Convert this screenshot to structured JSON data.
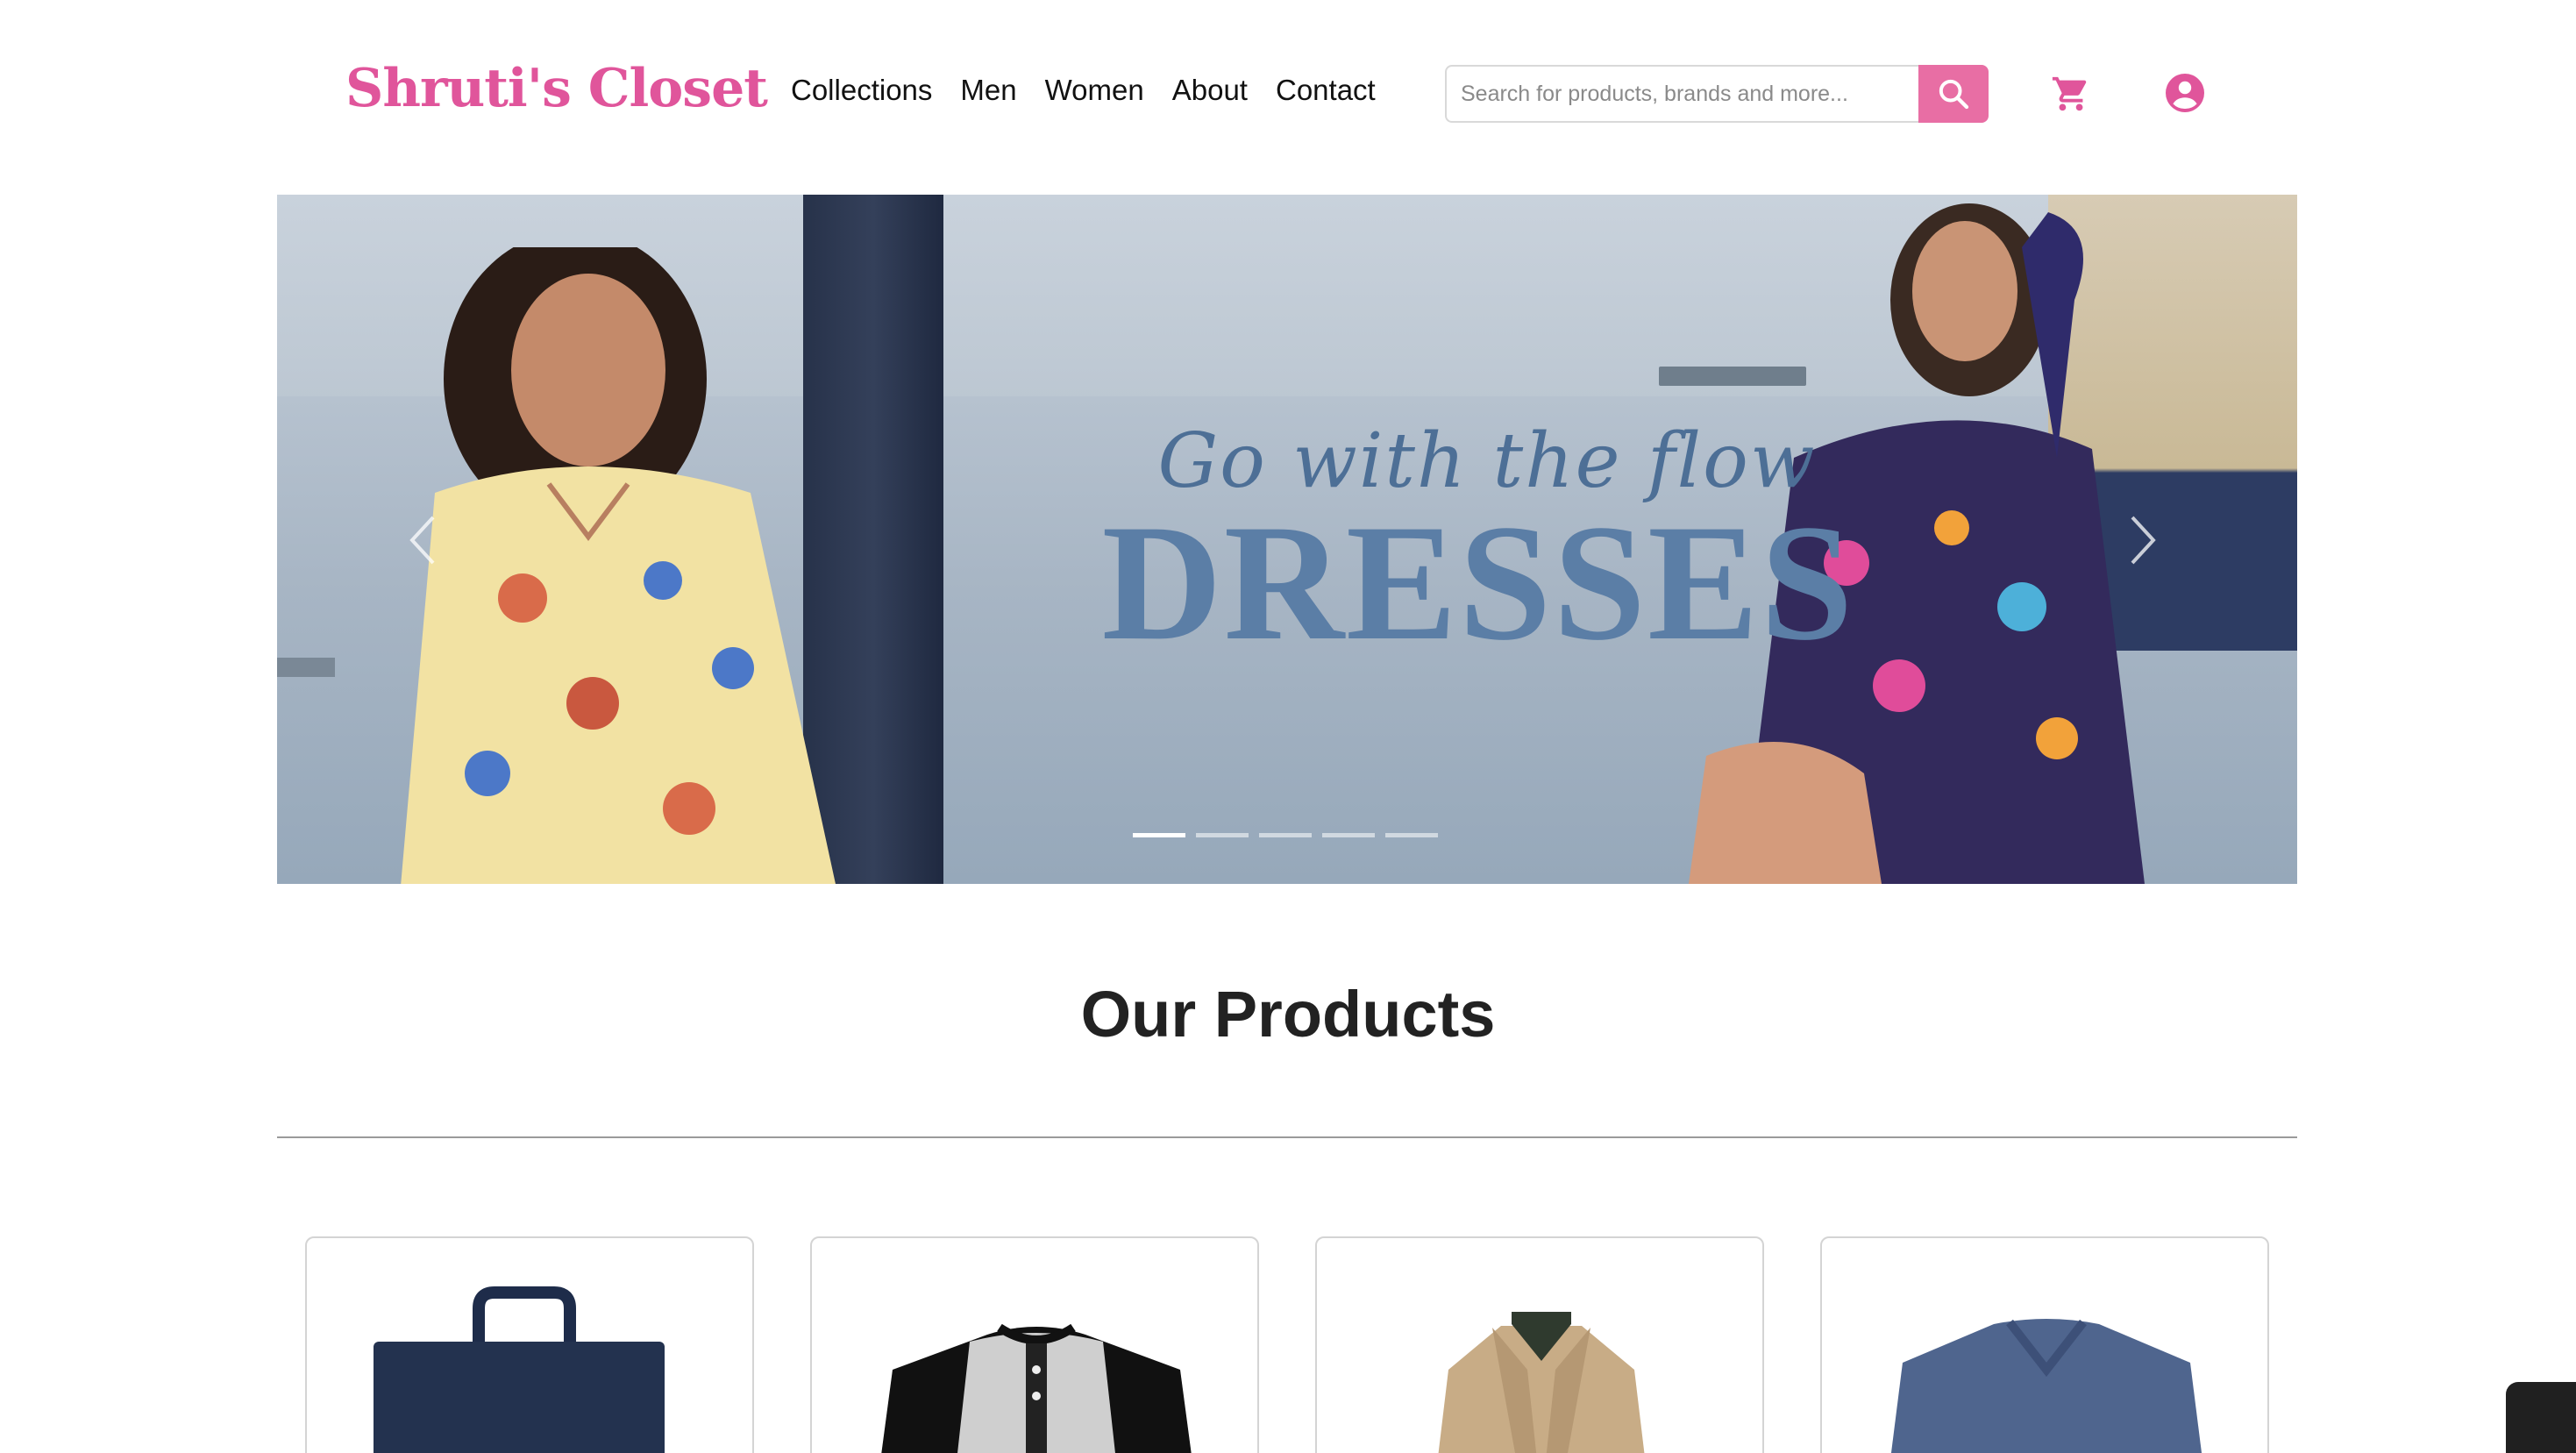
{
  "header": {
    "logo": "Shruti's Closet",
    "nav": [
      "Collections",
      "Men",
      "Women",
      "About",
      "Contact"
    ],
    "search_placeholder": "Search for products, brands and more..."
  },
  "icons": {
    "search": "search-icon",
    "cart": "cart-icon",
    "user": "user-icon",
    "prev": "chevron-left-icon",
    "next": "chevron-right-icon"
  },
  "banner": {
    "tagline": "Go with the flow",
    "headline": "DRESSES",
    "slide_count": 5,
    "active_slide": 1
  },
  "products": {
    "title": "Our Products",
    "items": [
      {
        "icon": "bag-image"
      },
      {
        "icon": "raglan-tshirt-image"
      },
      {
        "icon": "jacket-image"
      },
      {
        "icon": "vneck-tshirt-image"
      }
    ]
  },
  "colors": {
    "brand_pink": "#e0559b",
    "search_button": "#e86ea4",
    "headline_blue": "#5b7ea6"
  }
}
